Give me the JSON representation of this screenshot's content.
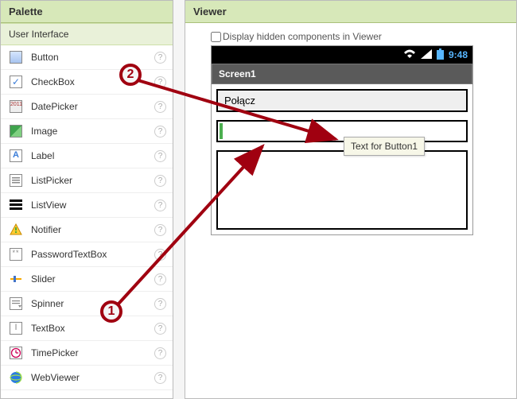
{
  "palette": {
    "title": "Palette",
    "category": "User Interface",
    "help_glyph": "?",
    "items": [
      {
        "label": "Button",
        "icon": "button-icon"
      },
      {
        "label": "CheckBox",
        "icon": "checkbox-icon"
      },
      {
        "label": "DatePicker",
        "icon": "date-icon"
      },
      {
        "label": "Image",
        "icon": "image-icon"
      },
      {
        "label": "Label",
        "icon": "label-icon"
      },
      {
        "label": "ListPicker",
        "icon": "listpicker-icon"
      },
      {
        "label": "ListView",
        "icon": "listview-icon"
      },
      {
        "label": "Notifier",
        "icon": "notifier-icon"
      },
      {
        "label": "PasswordTextBox",
        "icon": "password-icon"
      },
      {
        "label": "Slider",
        "icon": "slider-icon"
      },
      {
        "label": "Spinner",
        "icon": "spinner-icon"
      },
      {
        "label": "TextBox",
        "icon": "textbox-icon"
      },
      {
        "label": "TimePicker",
        "icon": "timepicker-icon"
      },
      {
        "label": "WebViewer",
        "icon": "webviewer-icon"
      }
    ]
  },
  "viewer": {
    "title": "Viewer",
    "show_hidden_label": "Display hidden components in Viewer",
    "show_hidden_checked": false,
    "status_time": "9:48",
    "screen_title": "Screen1",
    "button1_label": "Połącz",
    "tooltip_text": "Text for Button1"
  },
  "annotations": {
    "one": "1",
    "two": "2"
  }
}
